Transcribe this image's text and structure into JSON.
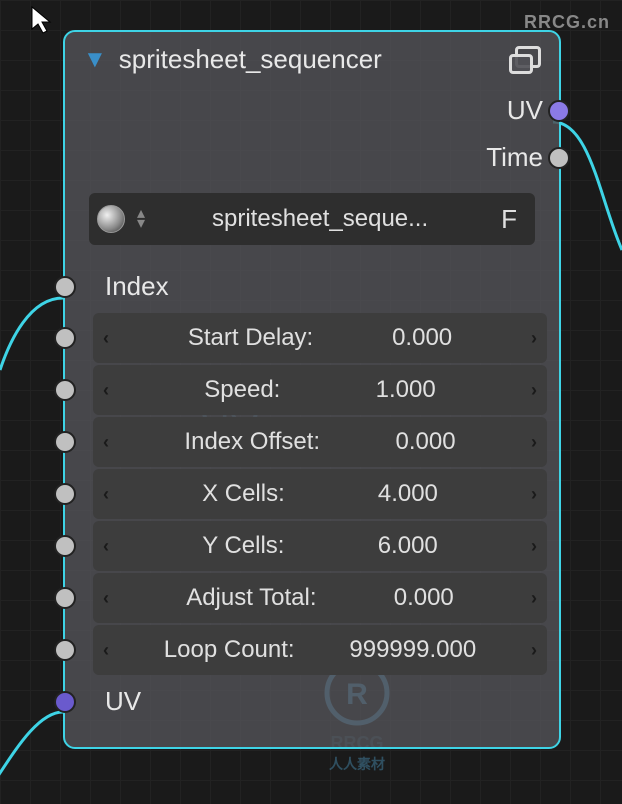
{
  "watermarks": {
    "top": "RRCG.cn",
    "bottom_cn": "人人素材",
    "bottom_en": "RRCG",
    "center_cn": "人人素材",
    "center_en": "RRCG"
  },
  "node": {
    "title": "spritesheet_sequencer",
    "group_selector": "spritesheet_seque...",
    "fake_user": "F",
    "outputs": [
      {
        "label": "UV",
        "type": "vector"
      },
      {
        "label": "Time",
        "type": "value"
      }
    ],
    "inputs": [
      {
        "label": "Index",
        "type": "value",
        "is_label": true
      },
      {
        "label": "Start Delay:",
        "value": "0.000",
        "type": "value"
      },
      {
        "label": "Speed:",
        "value": "1.000",
        "type": "value"
      },
      {
        "label": "Index Offset:",
        "value": "0.000",
        "type": "value"
      },
      {
        "label": "X Cells:",
        "value": "4.000",
        "type": "value"
      },
      {
        "label": "Y Cells:",
        "value": "6.000",
        "type": "value"
      },
      {
        "label": "Adjust Total:",
        "value": "0.000",
        "type": "value"
      },
      {
        "label": "Loop Count:",
        "value": "999999.000",
        "type": "value"
      },
      {
        "label": "UV",
        "type": "vector",
        "is_label": true
      }
    ]
  }
}
